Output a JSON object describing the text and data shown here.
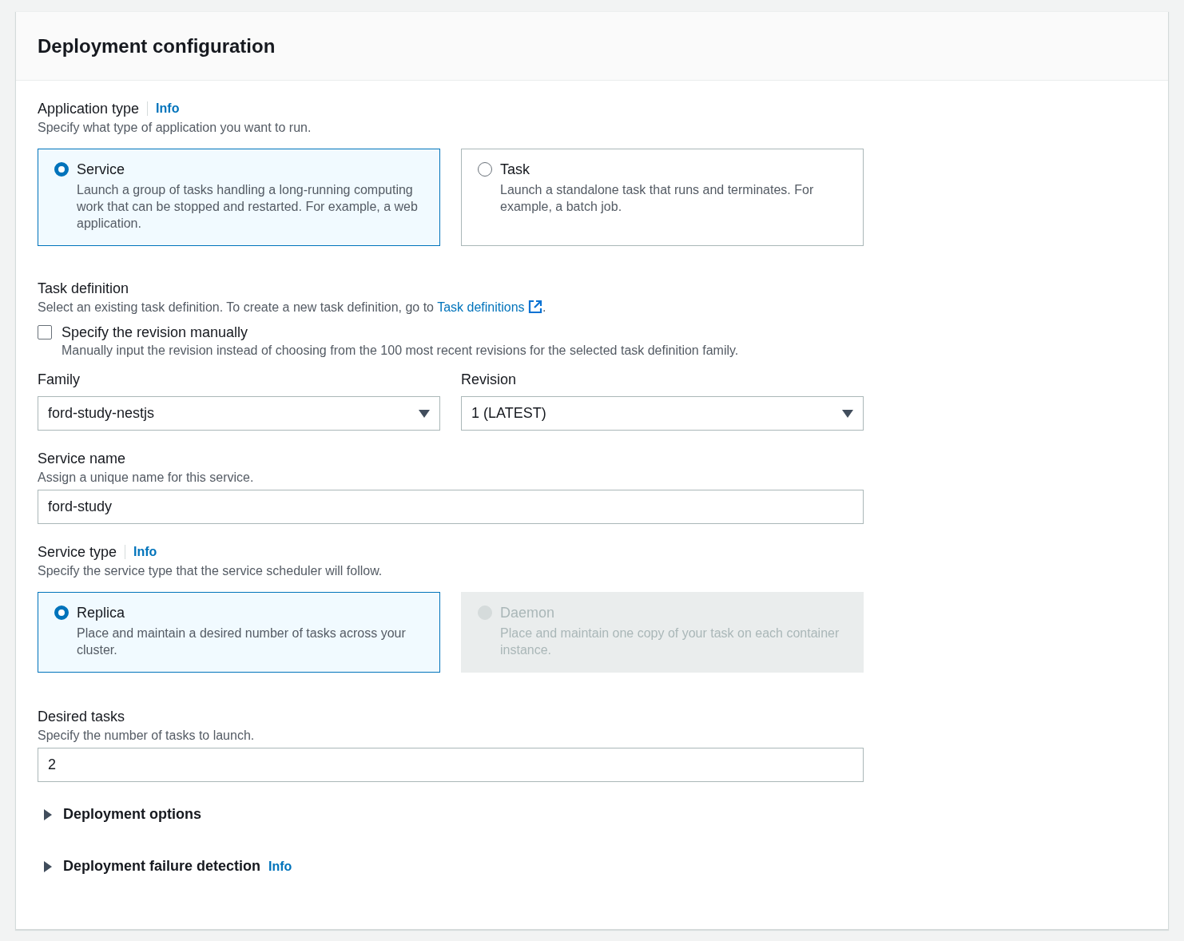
{
  "panel": {
    "title": "Deployment configuration"
  },
  "application_type": {
    "label": "Application type",
    "info": "Info",
    "description": "Specify what type of application you want to run.",
    "options": [
      {
        "label": "Service",
        "description": "Launch a group of tasks handling a long-running computing work that can be stopped and restarted. For example, a web application.",
        "selected": true,
        "disabled": false
      },
      {
        "label": "Task",
        "description": "Launch a standalone task that runs and terminates. For example, a batch job.",
        "selected": false,
        "disabled": false
      }
    ]
  },
  "task_definition": {
    "label": "Task definition",
    "description": "Select an existing task definition. To create a new task definition, go to ",
    "link": "Task definitions",
    "description_end": ".",
    "manual_revision": {
      "label": "Specify the revision manually",
      "description": "Manually input the revision instead of choosing from the 100 most recent revisions for the selected task definition family.",
      "checked": false
    },
    "family": {
      "label": "Family",
      "value": "ford-study-nestjs"
    },
    "revision": {
      "label": "Revision",
      "value": "1 (LATEST)"
    }
  },
  "service_name": {
    "label": "Service name",
    "description": "Assign a unique name for this service.",
    "value": "ford-study"
  },
  "service_type": {
    "label": "Service type",
    "info": "Info",
    "description": "Specify the service type that the service scheduler will follow.",
    "options": [
      {
        "label": "Replica",
        "description": "Place and maintain a desired number of tasks across your cluster.",
        "selected": true,
        "disabled": false
      },
      {
        "label": "Daemon",
        "description": "Place and maintain one copy of your task on each container instance.",
        "selected": false,
        "disabled": true
      }
    ]
  },
  "desired_tasks": {
    "label": "Desired tasks",
    "description": "Specify the number of tasks to launch.",
    "value": "2"
  },
  "sections": [
    {
      "label": "Deployment options",
      "expanded": false
    },
    {
      "label": "Deployment failure detection",
      "info": "Info",
      "expanded": false
    }
  ]
}
